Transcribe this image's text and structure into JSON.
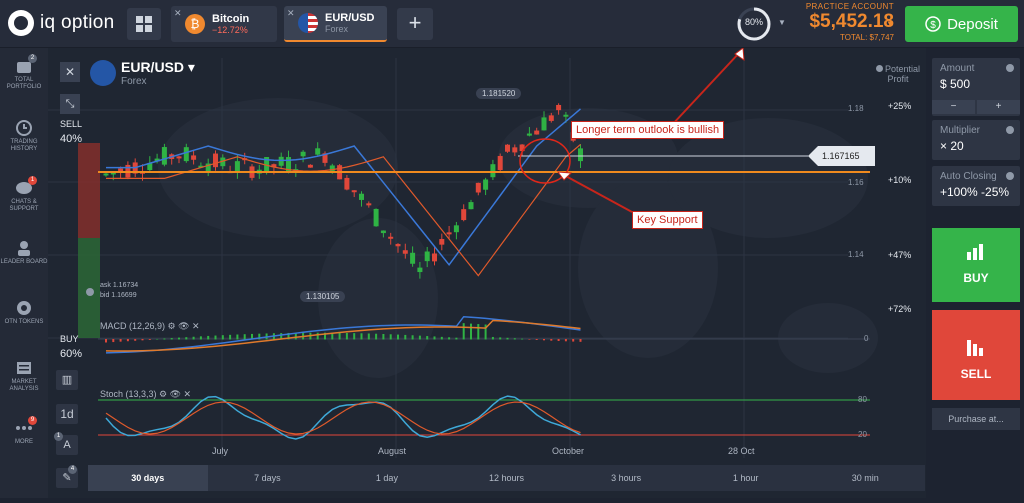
{
  "brand": {
    "name": "iq option"
  },
  "tabs": [
    {
      "name": "Bitcoin",
      "sub": "−12.72%",
      "sub_color": "#e0473a",
      "icon": "bitcoin-icon"
    },
    {
      "name": "EUR/USD",
      "sub": "Forex",
      "sub_color": "#8d96a5",
      "icon": "eurusd-flag-icon",
      "active": true
    }
  ],
  "account": {
    "label": "PRACTICE ACCOUNT",
    "balance": "$5,452.18",
    "total": "TOTAL: $7,747",
    "progress_label": "80%",
    "progress": 0.8
  },
  "deposit_label": "Deposit",
  "sidebar": [
    {
      "label": "TOTAL PORTFOLIO",
      "badge": "2",
      "icon": "portfolio-icon"
    },
    {
      "label": "TRADING HISTORY",
      "icon": "history-icon"
    },
    {
      "label": "CHATS & SUPPORT",
      "badge": "1",
      "icon": "chat-icon"
    },
    {
      "label": "LEADER BOARD",
      "icon": "leaderboard-icon"
    },
    {
      "label": "OTN TOKENS",
      "icon": "token-icon"
    },
    {
      "label": "MARKET ANALYSIS",
      "icon": "news-icon"
    },
    {
      "label": "MORE",
      "badge": "9",
      "icon": "more-icon"
    }
  ],
  "asset": {
    "name": "EUR/USD",
    "category": "Forex"
  },
  "sell": {
    "label": "SELL",
    "pct": "40%"
  },
  "buy": {
    "label": "BUY",
    "pct": "60%"
  },
  "chart_info": {
    "potential_profit": "Potential Profit",
    "ask": "ask 1.16734",
    "bid": "bid 1.16699",
    "high_label": "1.181520",
    "low_label": "1.130105",
    "current_price": "1.167165",
    "price_ticks": [
      "1.18",
      "1.16",
      "1.14"
    ],
    "profit_ticks": [
      "+25%",
      "+10%",
      "+47%",
      "+72%"
    ],
    "macd_label": "MACD (12,26,9)",
    "macd_zero": "0",
    "stoch_label": "Stoch (13,3,3)",
    "stoch_80": "80",
    "stoch_20": "20",
    "date_labels": [
      "July",
      "August",
      "October",
      "28 Oct"
    ],
    "timeframe": "1d"
  },
  "annotations": {
    "bullish": "Longer term outlook is bullish",
    "support": "Key Support"
  },
  "right_panel": {
    "amount_label": "Amount",
    "amount_value": "$ 500",
    "multiplier_label": "Multiplier",
    "multiplier_value": "× 20",
    "auto_label": "Auto Closing",
    "auto_value": "+100% -25%",
    "buy_label": "BUY",
    "sell_label": "SELL",
    "purchase_label": "Purchase at..."
  },
  "timebar": [
    "30 days",
    "7 days",
    "1 day",
    "12 hours",
    "3 hours",
    "1 hour",
    "30 min"
  ],
  "tool_badges": [
    "1",
    "4"
  ],
  "colors": {
    "accent": "#f0892f",
    "buy": "#35b44a",
    "sell": "#e0473a",
    "support_line": "#f08a1e",
    "macd": "#3a78d8",
    "signal": "#e07a2b"
  }
}
